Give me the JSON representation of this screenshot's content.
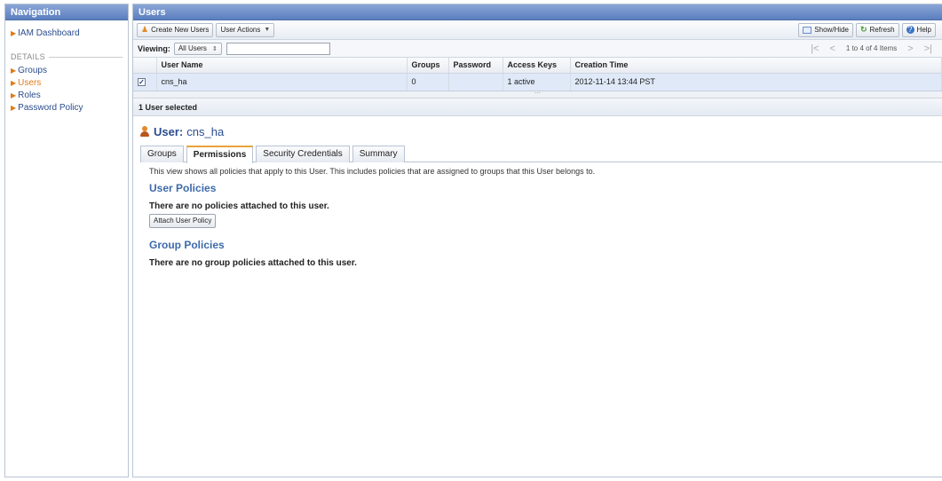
{
  "nav": {
    "title": "Navigation",
    "dashboard": "IAM Dashboard",
    "section": "DETAILS",
    "items": [
      {
        "label": "Groups"
      },
      {
        "label": "Users"
      },
      {
        "label": "Roles"
      },
      {
        "label": "Password Policy"
      }
    ]
  },
  "users_panel": {
    "title": "Users",
    "toolbar": {
      "create": "Create New Users",
      "actions": "User Actions",
      "showhide": "Show/Hide",
      "refresh": "Refresh",
      "help": "Help"
    },
    "viewing": {
      "label": "Viewing:",
      "value": "All Users",
      "filter": ""
    },
    "pager": "1 to 4 of 4 Items",
    "columns": [
      "User Name",
      "Groups",
      "Password",
      "Access Keys",
      "Creation Time"
    ],
    "rows": [
      {
        "name": "cns_ha",
        "groups": "0",
        "password": "",
        "keys": "1 active",
        "created": "2012-11-14 13:44 PST"
      }
    ],
    "selected": "1 User selected"
  },
  "detail": {
    "label": "User:",
    "user": "cns_ha",
    "tabs": [
      "Groups",
      "Permissions",
      "Security Credentials",
      "Summary"
    ],
    "active_tab": "Permissions",
    "intro": "This view shows all policies that apply to this User. This includes policies that are assigned to groups that this User belongs to.",
    "user_policies": {
      "title": "User Policies",
      "note": "There are no policies attached to this user.",
      "button": "Attach User Policy"
    },
    "group_policies": {
      "title": "Group Policies",
      "note": "There are no group policies attached to this user."
    }
  },
  "colors": {
    "header": "#5b7ebf",
    "link": "#2a4d8f",
    "active_link": "#e07b1a",
    "section_title": "#3d6aaa",
    "selected_row": "#dfe9f8"
  }
}
